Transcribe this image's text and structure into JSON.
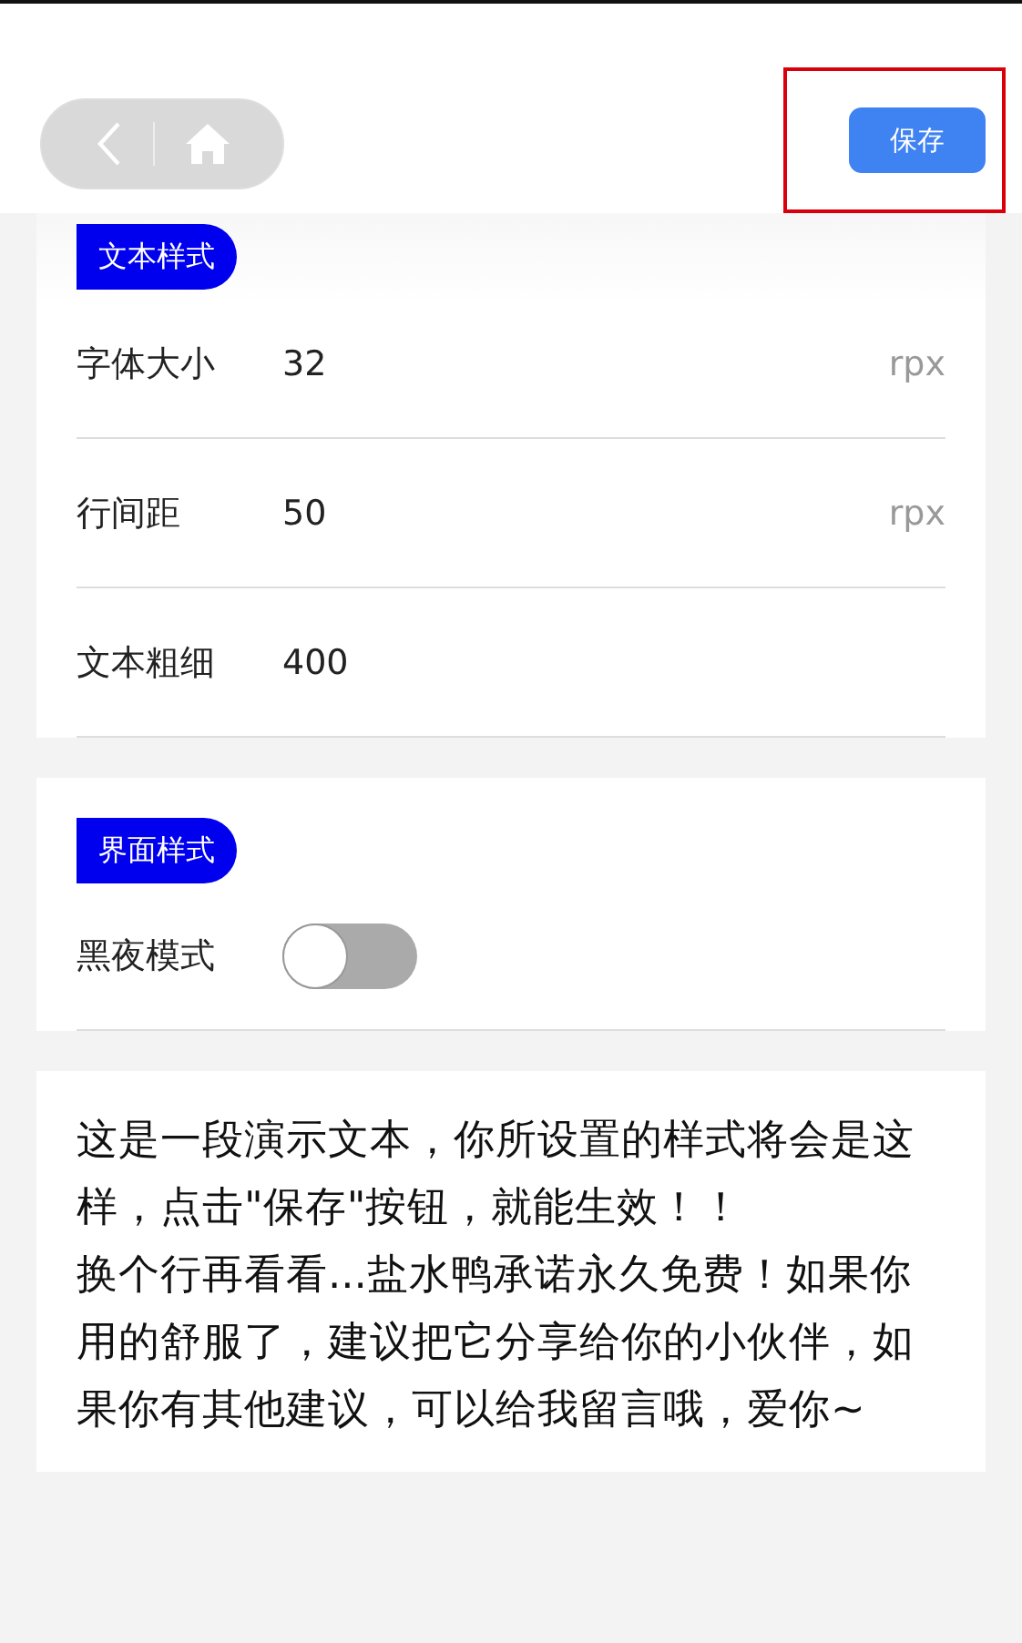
{
  "header": {
    "save_button": {
      "label": "保存",
      "highlighted": true
    }
  },
  "text_style": {
    "tag": "文本样式",
    "rows": [
      {
        "label": "字体大小",
        "value": "32",
        "unit": "rpx"
      },
      {
        "label": "行间距",
        "value": "50",
        "unit": "rpx"
      },
      {
        "label": "文本粗细",
        "value": "400"
      }
    ]
  },
  "ui_style": {
    "tag": "界面样式",
    "rows": [
      {
        "label": "黑夜模式",
        "on": false
      }
    ]
  },
  "preview": {
    "paragraphs": [
      "这是一段演示文本，你所设置的样式将会是这样，点击\"保存\"按钮，就能生效！！",
      "换个行再看看...盐水鸭承诺永久免费！如果你用的舒服了，建议把它分享给你的小伙伴，如果你有其他建议，可以给我留言哦，爱你~"
    ]
  }
}
